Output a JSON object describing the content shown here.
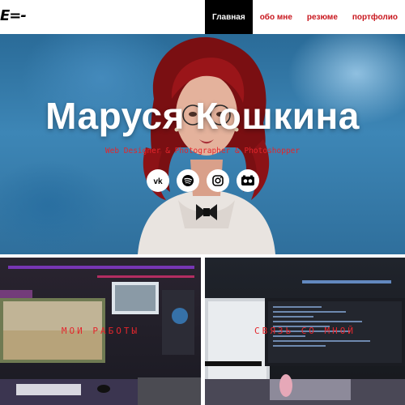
{
  "header": {
    "logo": "E=-",
    "nav": [
      {
        "label": "Главная",
        "active": true
      },
      {
        "label": "обо мне",
        "active": false
      },
      {
        "label": "резюме",
        "active": false
      },
      {
        "label": "портфолио",
        "active": false
      }
    ]
  },
  "hero": {
    "title": "Маруся Кошкина",
    "subtitle": "Web Designer & Photographer & Photoshopper",
    "socials": [
      {
        "icon": "vk-icon"
      },
      {
        "icon": "spotify-icon"
      },
      {
        "icon": "instagram-icon"
      },
      {
        "icon": "bandcamp-icon"
      }
    ]
  },
  "cards": [
    {
      "label": "МОИ РАБОТЫ"
    },
    {
      "label": "СВЯЗЬ СО МНОЙ"
    }
  ],
  "colors": {
    "accent": "#e3262c",
    "nav_active_bg": "#000000",
    "hero_bg": "#3d86b6"
  }
}
